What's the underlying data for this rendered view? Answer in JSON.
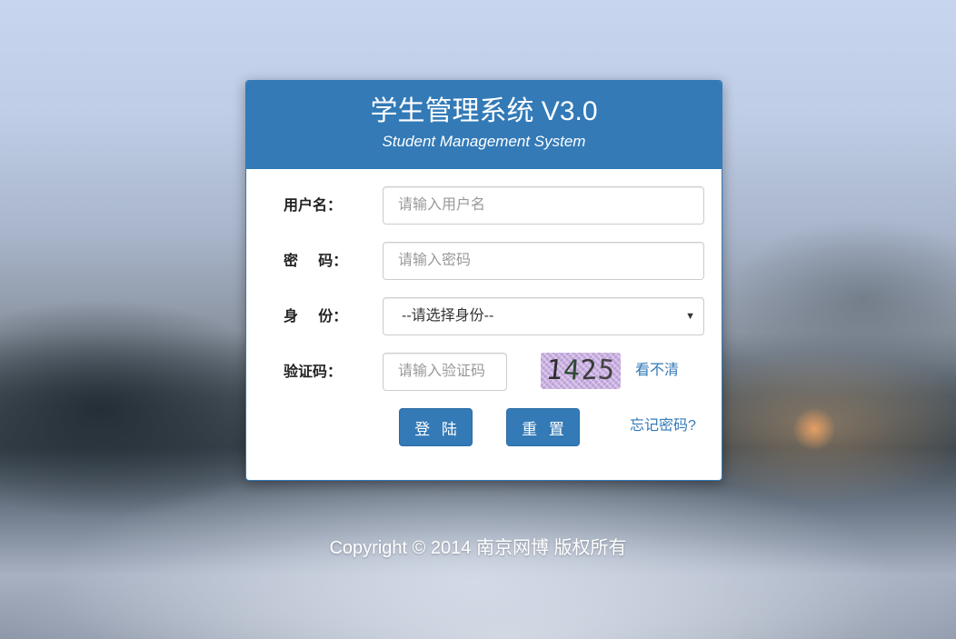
{
  "header": {
    "title": "学生管理系统 V3.0",
    "subtitle": "Student Management System"
  },
  "form": {
    "username": {
      "label": "用户名：",
      "placeholder": "请输入用户名",
      "value": ""
    },
    "password": {
      "label": "密    码：",
      "placeholder": "请输入密码",
      "value": ""
    },
    "role": {
      "label": "身    份：",
      "selected": "--请选择身份--",
      "arrow": "▼"
    },
    "captcha": {
      "label": "验证码：",
      "placeholder": "请输入验证码",
      "value": "",
      "image_digits": [
        "1",
        "4",
        "2",
        "5"
      ],
      "refresh_label": "看不清"
    }
  },
  "actions": {
    "login_label": "登 陆",
    "reset_label": "重 置",
    "forgot_label": "忘记密码?"
  },
  "footer": {
    "copyright": "Copyright © 2014 南京网博 版权所有"
  },
  "colors": {
    "primary": "#337ab7",
    "primary_border": "#2e6da4",
    "captcha_bg": "#c8aee0"
  }
}
